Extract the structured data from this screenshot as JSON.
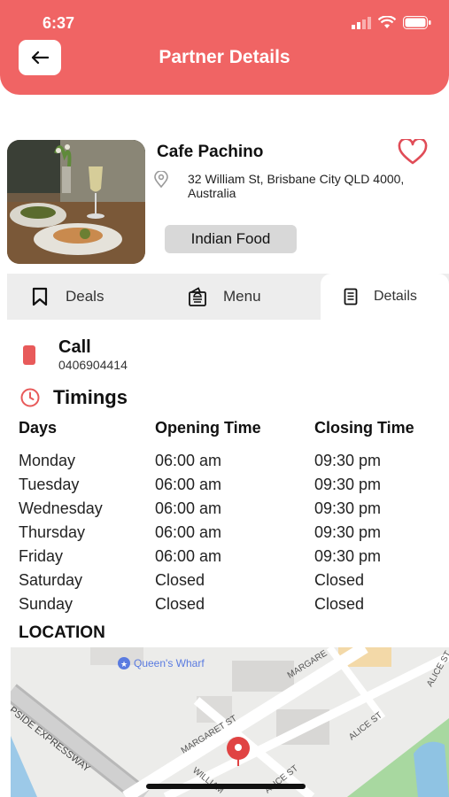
{
  "status_bar": {
    "time": "6:37"
  },
  "header": {
    "title": "Partner Details"
  },
  "partner": {
    "name": "Cafe Pachino",
    "address": "32 William St, Brisbane City QLD 4000, Australia",
    "tag": "Indian Food"
  },
  "tabs": [
    {
      "label": "Deals",
      "icon": "bookmark-icon"
    },
    {
      "label": "Menu",
      "icon": "menu-icon"
    },
    {
      "label": "Details",
      "icon": "document-icon",
      "active": true
    }
  ],
  "call": {
    "title": "Call",
    "number": "0406904414"
  },
  "timings": {
    "title": "Timings",
    "headers": {
      "days": "Days",
      "opening": "Opening Time",
      "closing": "Closing Time"
    },
    "rows": [
      {
        "day": "Monday",
        "open": "06:00 am",
        "close": "09:30 pm"
      },
      {
        "day": "Tuesday",
        "open": "06:00 am",
        "close": "09:30 pm"
      },
      {
        "day": "Wednesday",
        "open": "06:00 am",
        "close": "09:30 pm"
      },
      {
        "day": "Thursday",
        "open": "06:00 am",
        "close": "09:30 pm"
      },
      {
        "day": "Friday",
        "open": "06:00 am",
        "close": "09:30 pm"
      },
      {
        "day": "Saturday",
        "open": "Closed",
        "close": "Closed"
      },
      {
        "day": "Sunday",
        "open": "Closed",
        "close": "Closed"
      }
    ]
  },
  "location": {
    "title": "LOCATION",
    "map_labels": {
      "poi": "Queen's Wharf",
      "expressway": "PSIDE EXPRESSWAY",
      "street1": "MARGARET ST",
      "street2": "WILLIAM",
      "street3": "ALICE ST",
      "street4": "MARGARE",
      "street5": "ALICE ST",
      "street6": "ALICE ST"
    }
  },
  "colors": {
    "accent": "#f06464",
    "tab_bg": "#ededed",
    "tag_bg": "#d8d8d8"
  }
}
